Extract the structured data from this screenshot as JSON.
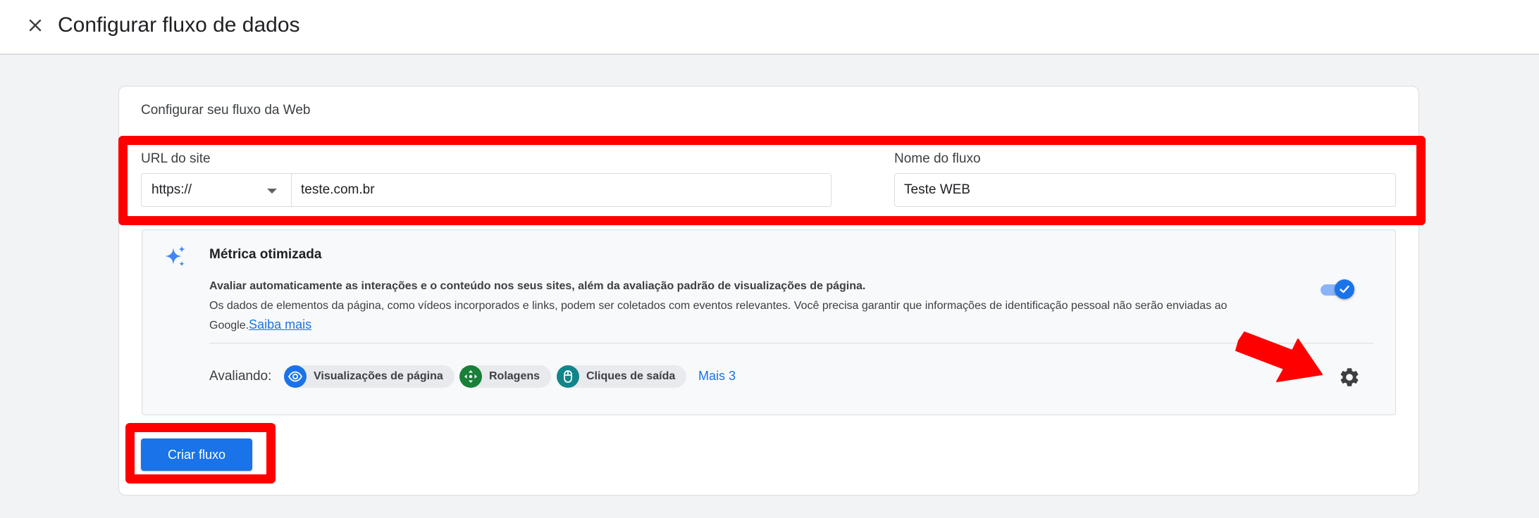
{
  "header": {
    "close_icon": "close-icon",
    "title": "Configurar fluxo de dados"
  },
  "card": {
    "heading": "Configurar seu fluxo da Web",
    "url_field": {
      "label": "URL do site",
      "protocol_selected": "https://",
      "value": "teste.com.br"
    },
    "stream_name_field": {
      "label": "Nome do fluxo",
      "value": "Teste WEB"
    },
    "enhanced_measurement": {
      "icon": "sparkle-icon",
      "title": "Métrica otimizada",
      "description_bold": "Avaliar automaticamente as interações e o conteúdo nos seus sites, além da avaliação padrão de visualizações de página.",
      "description": "Os dados de elementos da página, como vídeos incorporados e links, podem ser coletados com eventos relevantes. Você precisa garantir que informações de identificação pessoal não serão enviadas ao Google.",
      "learn_more": "Saiba mais",
      "toggle_on": true,
      "measuring_label": "Avaliando:",
      "chips": [
        {
          "label": "Visualizações de página",
          "icon": "eye-icon",
          "color": "#1a73e8"
        },
        {
          "label": "Rolagens",
          "icon": "scroll-icon",
          "color": "#188038"
        },
        {
          "label": "Cliques de saída",
          "icon": "mouse-icon",
          "color": "#12858a"
        }
      ],
      "more_label": "Mais 3",
      "settings_icon": "gear-icon"
    },
    "create_button": "Criar fluxo"
  },
  "colors": {
    "accent": "#1a73e8",
    "highlight": "#ff0000",
    "background": "#f1f3f4"
  }
}
